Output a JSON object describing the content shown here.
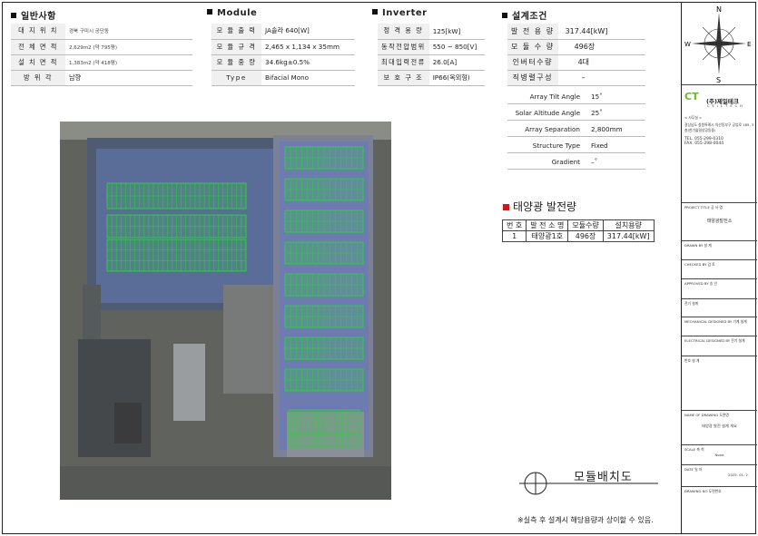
{
  "general": {
    "title": "일반사항",
    "rows": [
      {
        "label": "대 지 위 치",
        "value": "경북 구미시 공단동"
      },
      {
        "label": "전 체 면 적",
        "value": "2,629m2 (약 795평)"
      },
      {
        "label": "설 치 면 적",
        "value": "1,383m2 (약 418평)"
      },
      {
        "label": "방 위 각",
        "value": "남향"
      }
    ]
  },
  "module": {
    "title": "Module",
    "rows": [
      {
        "label": "모 듈 출 력",
        "value": "JA솔라 640[W]"
      },
      {
        "label": "모 듈 규 격",
        "value": "2,465 x 1,134 x 35mm"
      },
      {
        "label": "모 듈 중 량",
        "value": "34.6kg±0.5%"
      },
      {
        "label": "Type",
        "value": "Bifacial Mono"
      }
    ]
  },
  "inverter": {
    "title": "Inverter",
    "rows": [
      {
        "label": "정 격 용 량",
        "value": "125[kW]"
      },
      {
        "label": "동작전압범위",
        "value": "550 ~ 850[V]"
      },
      {
        "label": "최대입력전류",
        "value": "26.0[A]"
      },
      {
        "label": "보 호 구 조",
        "value": "IP66(옥외형)"
      }
    ]
  },
  "design": {
    "title": "설계조건",
    "rows": [
      {
        "label": "발 전 용 량",
        "value": "317.44[kW]"
      },
      {
        "label": "모 듈 수 량",
        "value": "496장"
      },
      {
        "label": "인버터수량",
        "value": "4대"
      },
      {
        "label": "직병렬구성",
        "value": "–"
      }
    ],
    "layout_rows": [
      {
        "label": "Array Tilt Angle",
        "value": "15˚"
      },
      {
        "label": "Solar Altitude Angle",
        "value": "25˚"
      },
      {
        "label": "Array Separation",
        "value": "2,800mm"
      },
      {
        "label": "Structure Type",
        "value": "Fixed"
      },
      {
        "label": "Gradient",
        "value": "–˚"
      }
    ]
  },
  "generation": {
    "title": "태양광 발전량",
    "headers": [
      "번 호",
      "발 전 소 명",
      "모듈수량",
      "설치용량"
    ],
    "rows": [
      [
        "1",
        "태양광1호",
        "496장",
        "317.44[kW]"
      ]
    ]
  },
  "plan_title": "모듈배치도",
  "note": "※실측 후 설계시 해당용량과 상이할 수 있음.",
  "compass": {
    "n": "N",
    "s": "S",
    "e": "E",
    "w": "W"
  },
  "titleblock": {
    "logo_text": "(주)제일테크",
    "logo_sub": "C E I L T E C H",
    "office_label": "< 사무실 >",
    "address": "경상남도 창원특례시 의산동부구 공업로 185, 3층(한기술밀양공동중)",
    "tel": "TEL. 055-299-0310",
    "fax": "FAX. 055-298-0044",
    "project_label": "PROJECT TITLE 공 사 명",
    "project_value": "태양광발전소",
    "cells": [
      "DRAWN BY 설 계",
      "CHECKED BY 검 토",
      "APPROVED BY 승 인",
      "전기 설계",
      "MECHANICAL DESIGNED BY 기계 설계",
      "ELECTRICAL DESIGNED BY 전기 설계",
      "번호 설 계"
    ],
    "drawing_title_label": "NAME OF DRAWING 도면명",
    "drawing_title_value": "태양광 발전 설계 개요",
    "scale_label": "SCALE 축 척",
    "scale_value": "None",
    "date_label": "DATE 일 자",
    "date_value": "2025. 01. 2.",
    "drawing_no_label": "DRAWING NO 도면번호"
  }
}
